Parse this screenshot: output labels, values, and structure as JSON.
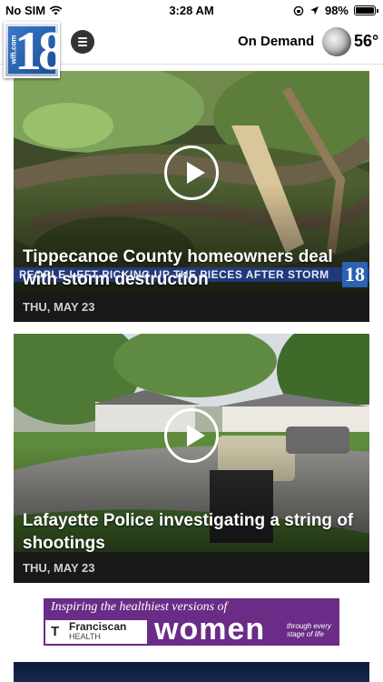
{
  "status_bar": {
    "carrier": "No SIM",
    "time": "3:28 AM",
    "battery_percent": "98%",
    "battery_level": 0.98
  },
  "header": {
    "logo_text": "18",
    "logo_site": "wlfi.com",
    "on_demand_label": "On Demand",
    "temperature": "56°",
    "weather_icon": "moon-icon"
  },
  "stories": [
    {
      "title": "Tippecanoe County homeowners deal with storm destruction",
      "date": "THU, MAY 23",
      "ticker": "PEOPLE LEFT PICKING UP THE PIECES AFTER STORM"
    },
    {
      "title": "Lafayette Police investigating a string of shootings",
      "date": "THU, MAY 23"
    }
  ],
  "ad": {
    "headline": "Inspiring the healthiest versions of",
    "brand": "Franciscan",
    "brand_sub": "HEALTH",
    "big_word": "women",
    "tagline": "through every stage of life"
  },
  "colors": {
    "ad_purple": "#6a2c86",
    "ticker_blue": "#233c8c",
    "card_footer": "#191919"
  }
}
